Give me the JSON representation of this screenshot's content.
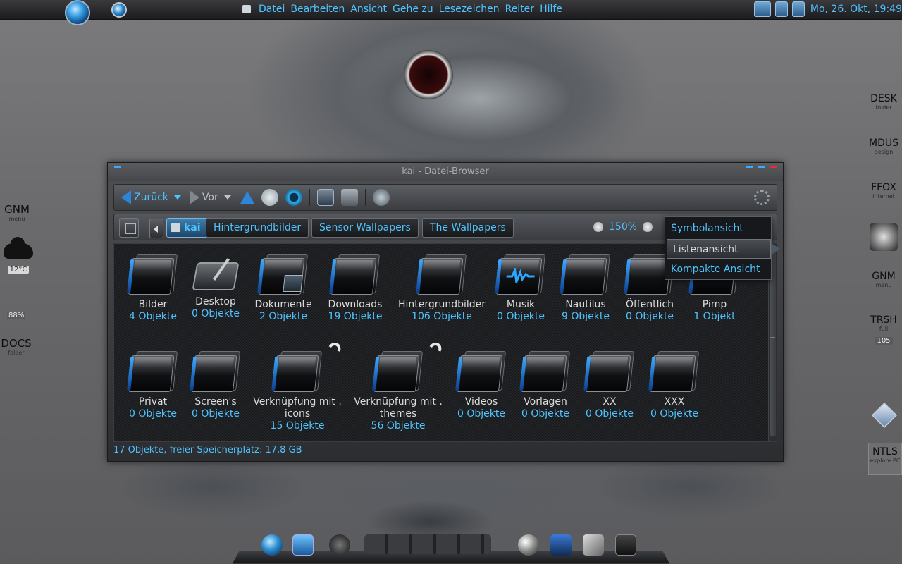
{
  "top_menu": [
    "Datei",
    "Bearbeiten",
    "Ansicht",
    "Gehe zu",
    "Lesezeichen",
    "Reiter",
    "Hilfe"
  ],
  "clock": "Mo, 26. Okt, 19:49",
  "left_desk": {
    "gnm": {
      "title": "GNM",
      "sub": "menu"
    },
    "weather_temp": "12°C",
    "percent": "88%",
    "docs": {
      "title": "DOCS",
      "sub": "folder"
    }
  },
  "right_desk": {
    "desk": {
      "title": "DESK",
      "sub": "folder"
    },
    "mdus": {
      "title": "MDUS",
      "sub": "design"
    },
    "ffox": {
      "title": "FFOX",
      "sub": "internet"
    },
    "gnm": {
      "title": "GNM",
      "sub": "menu"
    },
    "trsh": {
      "title": "TRSH",
      "sub": "full",
      "badge": "105"
    },
    "ntls": {
      "title": "NTLS",
      "sub": "explore PC"
    }
  },
  "window": {
    "title": "kai - Datei-Browser",
    "toolbar": {
      "back": "Zurück",
      "forward": "Vor"
    },
    "breadcrumbs": [
      "kai",
      "Hintergrundbilder",
      "Sensor Wallpapers",
      "The Wallpapers"
    ],
    "zoom": "150%",
    "view_menu": [
      "Symbolansicht",
      "Listenansicht",
      "Kompakte Ansicht"
    ],
    "status": "17 Objekte, freier Speicherplatz: 17,8 GB"
  },
  "items": [
    {
      "name": "Bilder",
      "count": "4 Objekte"
    },
    {
      "name": "Desktop",
      "count": "0 Objekte"
    },
    {
      "name": "Dokumente",
      "count": "2 Objekte"
    },
    {
      "name": "Downloads",
      "count": "19 Objekte"
    },
    {
      "name": "Hintergrundbilder",
      "count": "106 Objekte"
    },
    {
      "name": "Musik",
      "count": "0 Objekte"
    },
    {
      "name": "Nautilus",
      "count": "9 Objekte"
    },
    {
      "name": "Öffentlich",
      "count": "0 Objekte"
    },
    {
      "name": "Pimp",
      "count": "1 Objekt"
    },
    {
      "name": "Privat",
      "count": "0 Objekte"
    },
    {
      "name": "Screen's",
      "count": "0 Objekte"
    },
    {
      "name": "Verknüpfung mit .",
      "name2": "icons",
      "count": "15 Objekte"
    },
    {
      "name": "Verknüpfung mit .",
      "name2": "themes",
      "count": "56 Objekte"
    },
    {
      "name": "Videos",
      "count": "0 Objekte"
    },
    {
      "name": "Vorlagen",
      "count": "0 Objekte"
    },
    {
      "name": "XX",
      "count": "0 Objekte"
    },
    {
      "name": "XXX",
      "count": "0 Objekte"
    }
  ],
  "icons": {
    "accent": "#4fc3ff",
    "folder_stripe": "#2a8cff"
  }
}
